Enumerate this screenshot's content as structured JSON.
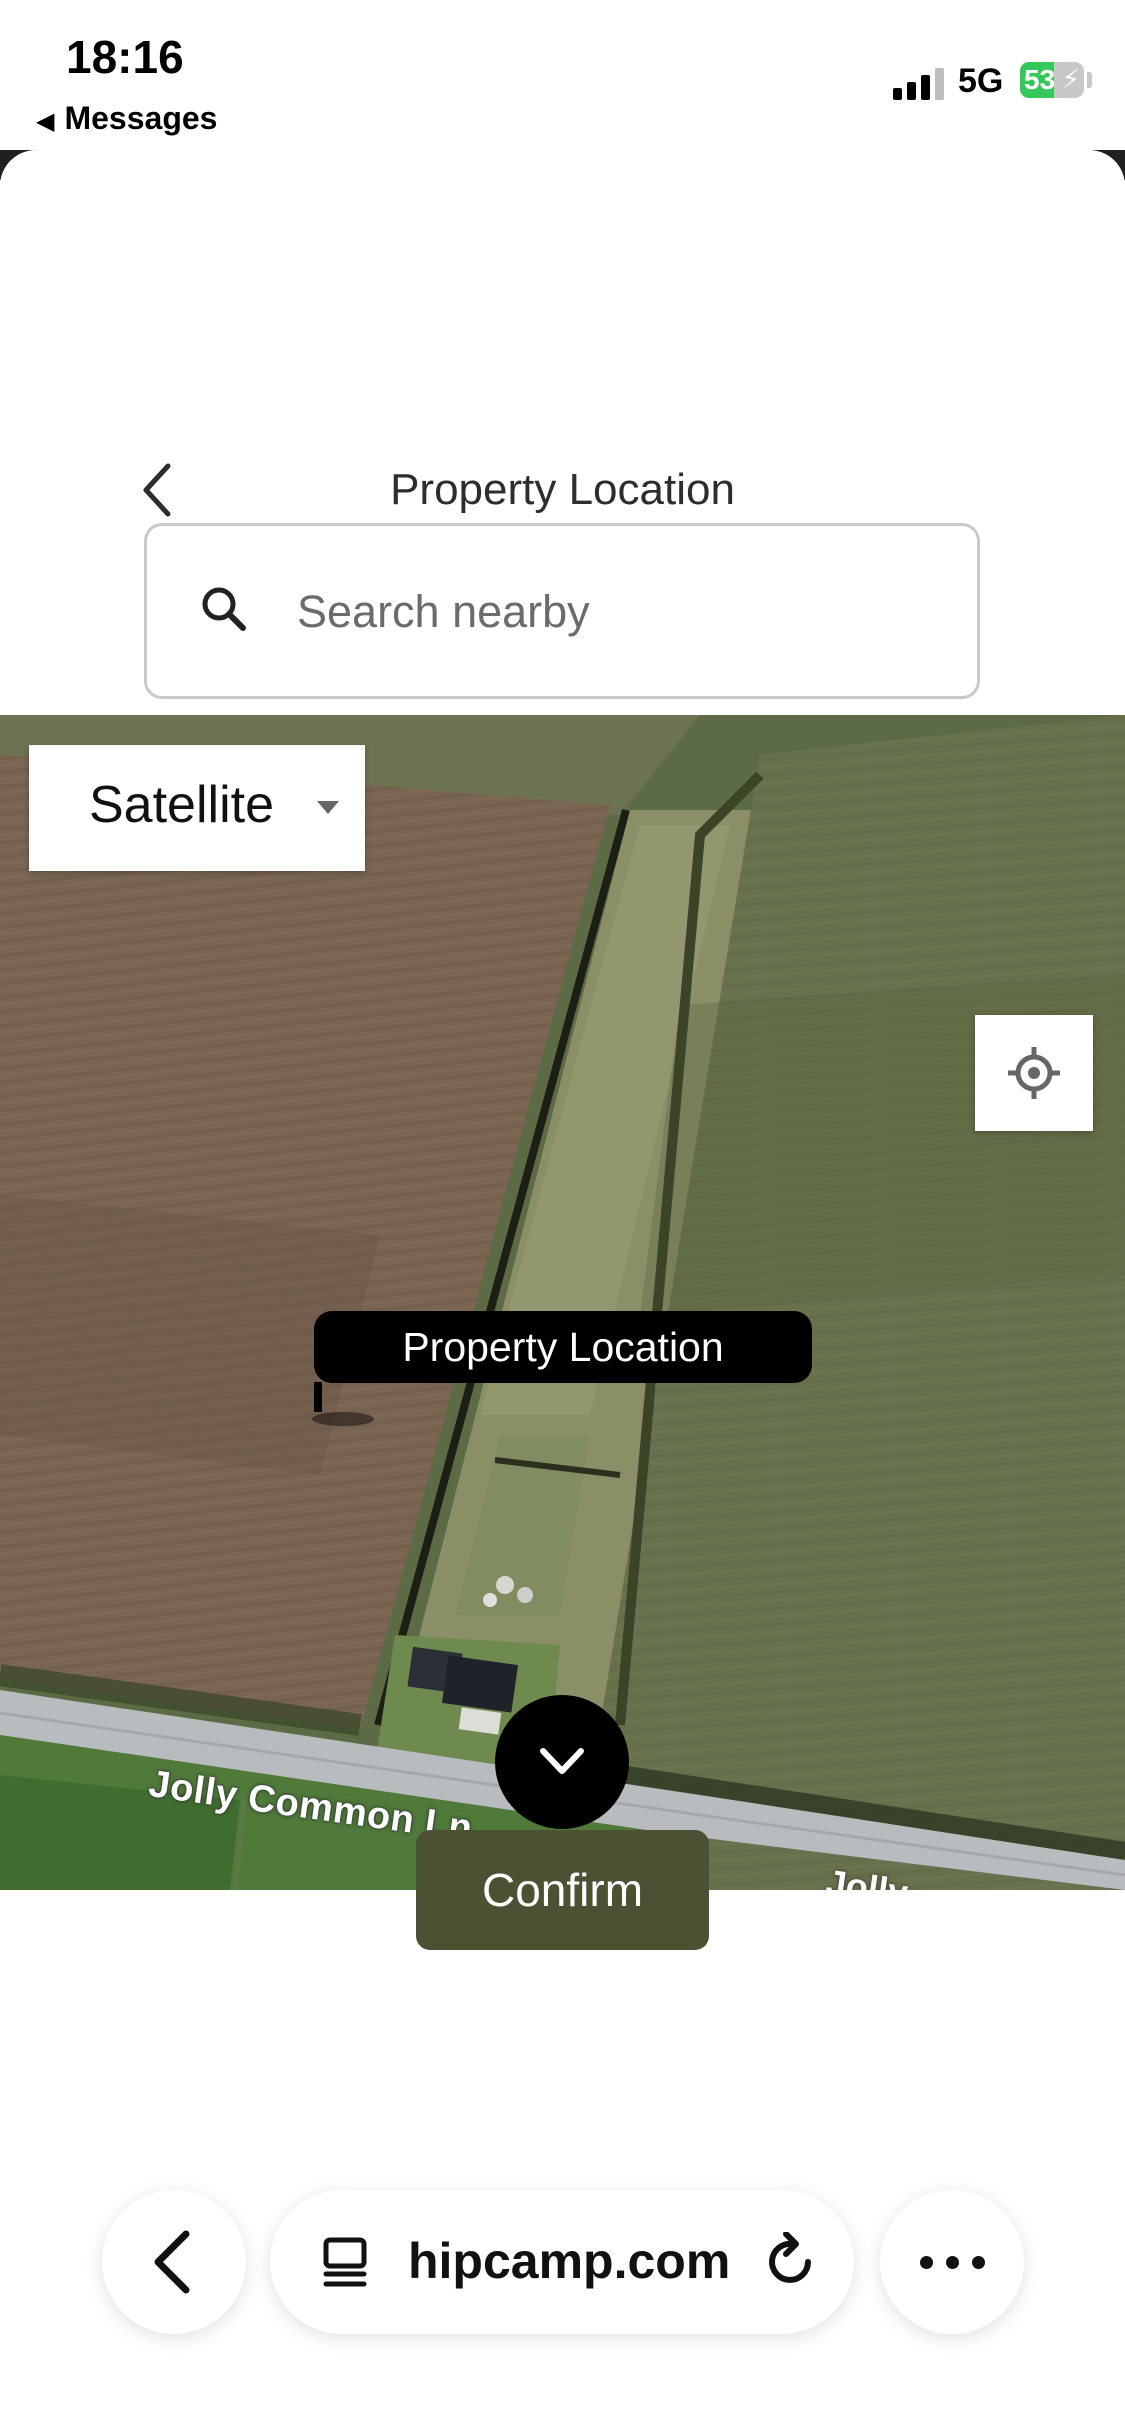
{
  "status_bar": {
    "time": "18:16",
    "back_app": "Messages",
    "network": "5G",
    "battery_percent": "53",
    "battery_level": 0.53
  },
  "header": {
    "title": "Property Location"
  },
  "search": {
    "placeholder": "Search nearby",
    "value": ""
  },
  "map": {
    "type_selector": "Satellite",
    "pin_label": "Property Location",
    "road_label": "Jolly Common Ln",
    "road_label_partial": "Jolly"
  },
  "actions": {
    "confirm_label": "Confirm"
  },
  "browser": {
    "url": "hipcamp.com"
  },
  "colors": {
    "confirm_bg": "#4b5132",
    "pin_bg": "#000000",
    "battery_green": "#34c759"
  }
}
